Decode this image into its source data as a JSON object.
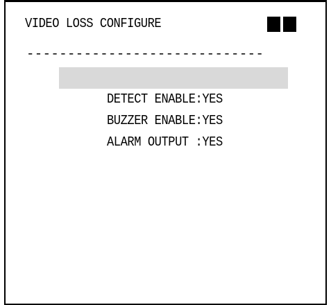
{
  "screen": {
    "title": "VIDEO LOSS CONFIGURE",
    "divider": "-----------------------------"
  },
  "menu": {
    "items": [
      {
        "label": "DETECT ENABLE:YES",
        "selected": true
      },
      {
        "label": "BUZZER ENABLE:YES",
        "selected": false
      },
      {
        "label": "ALARM OUTPUT :YES",
        "selected": false
      }
    ]
  },
  "colors": {
    "background": "#ffffff",
    "text": "#000000",
    "highlight": "#d9d9d9"
  }
}
